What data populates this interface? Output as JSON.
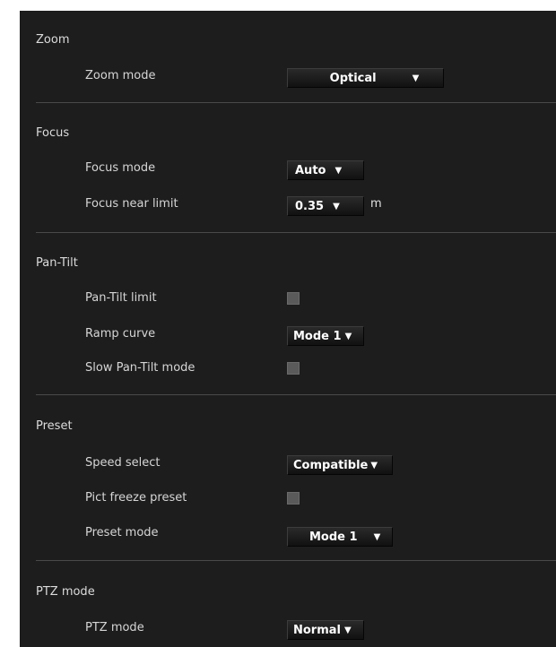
{
  "zoom": {
    "title": "Zoom",
    "zoom_mode_label": "Zoom mode",
    "zoom_mode_value": "Optical"
  },
  "focus": {
    "title": "Focus",
    "focus_mode_label": "Focus mode",
    "focus_mode_value": "Auto",
    "near_limit_label": "Focus near limit",
    "near_limit_value": "0.35",
    "near_limit_unit": "m"
  },
  "pan_tilt": {
    "title": "Pan-Tilt",
    "limit_label": "Pan-Tilt limit",
    "limit_checked": false,
    "ramp_label": "Ramp curve",
    "ramp_value": "Mode 1",
    "slow_label": "Slow Pan-Tilt mode",
    "slow_checked": false
  },
  "preset": {
    "title": "Preset",
    "speed_label": "Speed select",
    "speed_value": "Compatible",
    "freeze_label": "Pict freeze preset",
    "freeze_checked": false,
    "mode_label": "Preset mode",
    "mode_value": "Mode 1"
  },
  "ptz": {
    "title": "PTZ mode",
    "mode_label": "PTZ mode",
    "mode_value": "Normal"
  },
  "arrow_glyph": "▼"
}
